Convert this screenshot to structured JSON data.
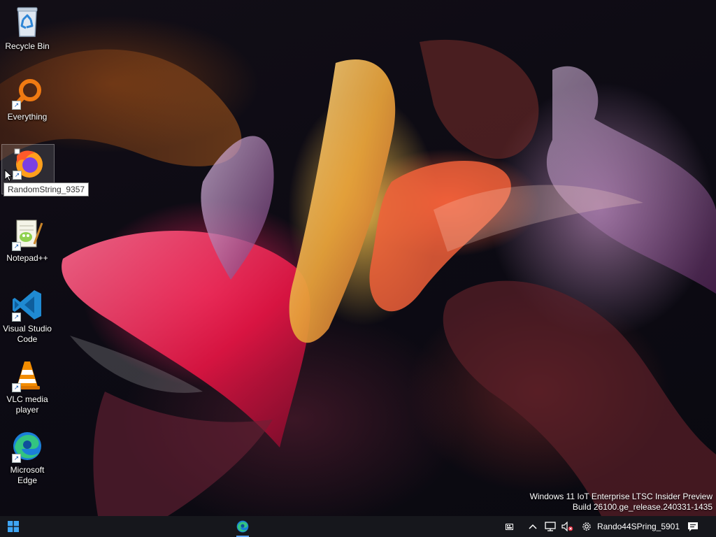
{
  "desktop": {
    "icons": [
      {
        "label": "Recycle Bin",
        "icon": "recycle-bin-icon"
      },
      {
        "label": "Everything",
        "icon": "everything-search-icon"
      },
      {
        "label": "",
        "icon": "firefox-icon"
      },
      {
        "label": "Notepad++",
        "icon": "notepad-plus-plus-icon"
      },
      {
        "label": "Visual Studio Code",
        "icon": "vscode-icon"
      },
      {
        "label": "VLC media player",
        "icon": "vlc-icon"
      },
      {
        "label": "Microsoft Edge",
        "icon": "edge-icon"
      }
    ],
    "tooltip": "RandomString_9357"
  },
  "watermark": {
    "line1": "Windows 11 IoT Enterprise LTSC Insider Preview",
    "line2": "Build 26100.ge_release.240331-1435"
  },
  "taskbar": {
    "start_icon": "windows-logo-icon",
    "pinned": [
      {
        "name": "Microsoft Edge",
        "icon": "edge-icon",
        "active": true
      }
    ],
    "tray": {
      "icons": [
        "keyboard-icon",
        "chevron-up-icon",
        "network-icon",
        "volume-muted-icon",
        "settings-gear-icon"
      ],
      "user_label": "Rando44SPring_5901",
      "notification_icon": "notification-icon"
    }
  },
  "colors": {
    "taskbar_bg": "#16171c",
    "accent": "#5ea0ef"
  }
}
